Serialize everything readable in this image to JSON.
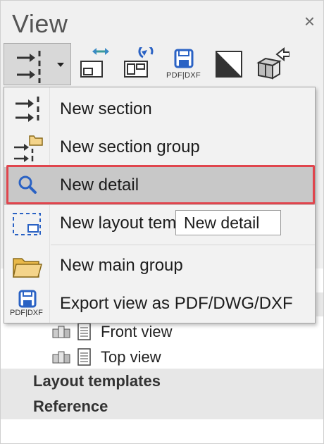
{
  "panel": {
    "title": "View",
    "close_glyph": "×"
  },
  "toolbar": {
    "buttons": [
      {
        "icon": "new-section-icon"
      },
      {
        "icon": "swap-layout-icon"
      },
      {
        "icon": "refresh-layout-icon"
      },
      {
        "icon": "save-pdf-dxf-icon",
        "caption": "PDF|DXF"
      },
      {
        "icon": "half-shaded-square-icon"
      },
      {
        "icon": "import-model-icon"
      }
    ]
  },
  "menu": {
    "items": [
      {
        "label": "New section",
        "icon": "new-section-icon"
      },
      {
        "label": "New section group",
        "icon": "new-section-group-icon"
      },
      {
        "label": "New detail",
        "icon": "magnifier-icon",
        "highlighted": true
      },
      {
        "label": "New layout tem",
        "icon": "layout-template-icon"
      },
      {
        "label": "New main group",
        "icon": "folder-icon"
      },
      {
        "label": "Export view as PDF/DWG/DXF",
        "icon": "save-pdf-dxf-icon",
        "icon_caption": "PDF|DXF"
      }
    ]
  },
  "tooltip": {
    "text": "New detail"
  },
  "tree": {
    "items": [
      {
        "label": "Front view"
      },
      {
        "label": "Top view"
      }
    ],
    "headers": [
      {
        "label": "Layout templates"
      },
      {
        "label": "Reference"
      }
    ]
  },
  "colors": {
    "highlight_border": "#e0454d",
    "highlight_fill": "#c8c8c8",
    "icon_blue": "#2a62c4",
    "folder_fill": "#f4d48a"
  }
}
